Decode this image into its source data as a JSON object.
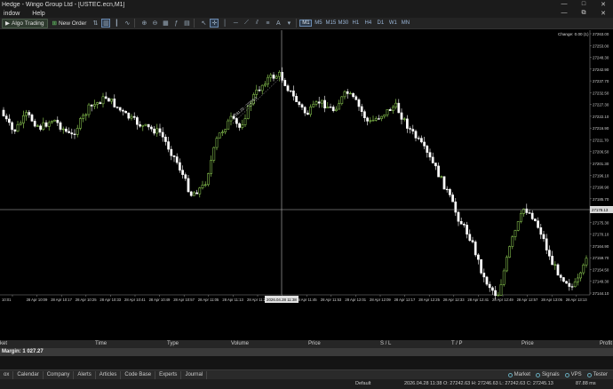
{
  "window": {
    "title": "Hedge - Wingo Group Ltd - [USTEC.ecn,M1]",
    "buttons": [
      "—",
      "□",
      "✕"
    ]
  },
  "menu": {
    "items": [
      "indow",
      "Help"
    ],
    "right_buttons": [
      "—",
      "⧉",
      "✕"
    ]
  },
  "toolbar": {
    "algo_label": "Algo Trading",
    "new_order_label": "New Order",
    "timeframes": [
      "M1",
      "M5",
      "M15",
      "M30",
      "H1",
      "H4",
      "D1",
      "W1",
      "MN"
    ],
    "active_timeframe": "M1"
  },
  "chart": {
    "change_label": "Change: 0.00 (1)",
    "current_price_label": "27178.13",
    "trend_annotation": "27281.20 : 27279.3",
    "crosshair_time_label": "2026.04.28 11:38",
    "bull_color": "#9be05a",
    "bear_color": "#ffffff",
    "grid_color": "#333333",
    "price_axis": [
      "27263.00",
      "27253.00",
      "27248.30",
      "27242.90",
      "27237.70",
      "27232.50",
      "27227.30",
      "27222.10",
      "27216.90",
      "27211.70",
      "27206.50",
      "27201.30",
      "27196.10",
      "27190.90",
      "27185.70",
      "27180.50",
      "27175.30",
      "27170.10",
      "27164.90",
      "27159.70",
      "27154.50",
      "27149.30",
      "27144.10"
    ],
    "time_axis": [
      "10:01",
      "28 Apr 10:09",
      "28 Apr 10:17",
      "28 Apr 10:25",
      "28 Apr 10:33",
      "28 Apr 10:41",
      "28 Apr 10:49",
      "28 Apr 10:57",
      "28 Apr 11:05",
      "28 Apr 11:13",
      "28 Apr 11:21",
      "",
      "28 Apr 11:45",
      "28 Apr 11:53",
      "28 Apr 12:01",
      "28 Apr 12:09",
      "28 Apr 12:17",
      "28 Apr 12:25",
      "28 Apr 12:33",
      "28 Apr 12:41",
      "28 Apr 12:49",
      "28 Apr 12:57",
      "28 Apr 13:05",
      "28 Apr 13:13"
    ]
  },
  "orders_header": {
    "columns": [
      "ket",
      "Time",
      "Type",
      "Volume",
      "Price",
      "S / L",
      "T / P",
      "Price",
      "Profit"
    ]
  },
  "margin_row": {
    "text": "Margin: 1 027.27"
  },
  "bottom_tabs": {
    "items": [
      "ox",
      "Calendar",
      "Company",
      "Alerts",
      "Articles",
      "Code Base",
      "Experts",
      "Journal"
    ],
    "right": [
      "Market",
      "Signals",
      "VPS",
      "Tester"
    ]
  },
  "status": {
    "profile": "Default",
    "ohlc": "2026.04.28 11:38   O: 27242.63   H: 27246.63   L: 27242.63   C: 27245.13",
    "ping": "87.88 ms"
  }
}
